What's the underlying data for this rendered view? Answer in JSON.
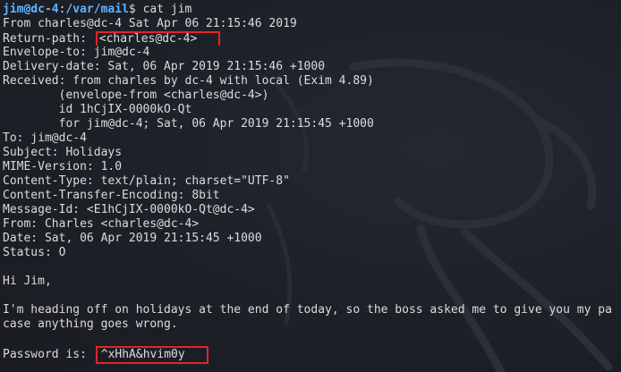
{
  "prompt": {
    "user_host": "jim@dc-4",
    "sep": ":",
    "path": "/var/mail",
    "sign": "$ ",
    "command": "cat jim"
  },
  "mail": {
    "from_line": "From charles@dc-4 Sat Apr 06 21:15:46 2019",
    "return_path_key": "Return-path:",
    "return_path_val": "<charles@dc-4>",
    "envelope_to": "Envelope-to: jim@dc-4",
    "delivery_date": "Delivery-date: Sat, 06 Apr 2019 21:15:46 +1000",
    "received_1": "Received: from charles by dc-4 with local (Exim 4.89)",
    "received_2": "        (envelope-from <charles@dc-4>)",
    "received_3": "        id 1hCjIX-0000kO-Qt",
    "received_4": "        for jim@dc-4; Sat, 06 Apr 2019 21:15:45 +1000",
    "to": "To: jim@dc-4",
    "subject": "Subject: Holidays",
    "mime": "MIME-Version: 1.0",
    "content_type": "Content-Type: text/plain; charset=\"UTF-8\"",
    "encoding": "Content-Transfer-Encoding: 8bit",
    "message_id": "Message-Id: <E1hCjIX-0000kO-Qt@dc-4>",
    "from": "From: Charles <charles@dc-4>",
    "date": "Date: Sat, 06 Apr 2019 21:15:45 +1000",
    "status": "Status: O",
    "greeting": "Hi Jim,",
    "body_1": "I'm heading off on holidays at the end of today, so the boss asked me to give you my pa",
    "body_2": "case anything goes wrong.",
    "password_key": "Password is:",
    "password_val": "^xHhA&hvim0y"
  },
  "colors": {
    "background": "#1d1f26",
    "prompt": "#5fb4ff",
    "text": "#dcdcdc",
    "highlight_box": "#e0252b"
  }
}
